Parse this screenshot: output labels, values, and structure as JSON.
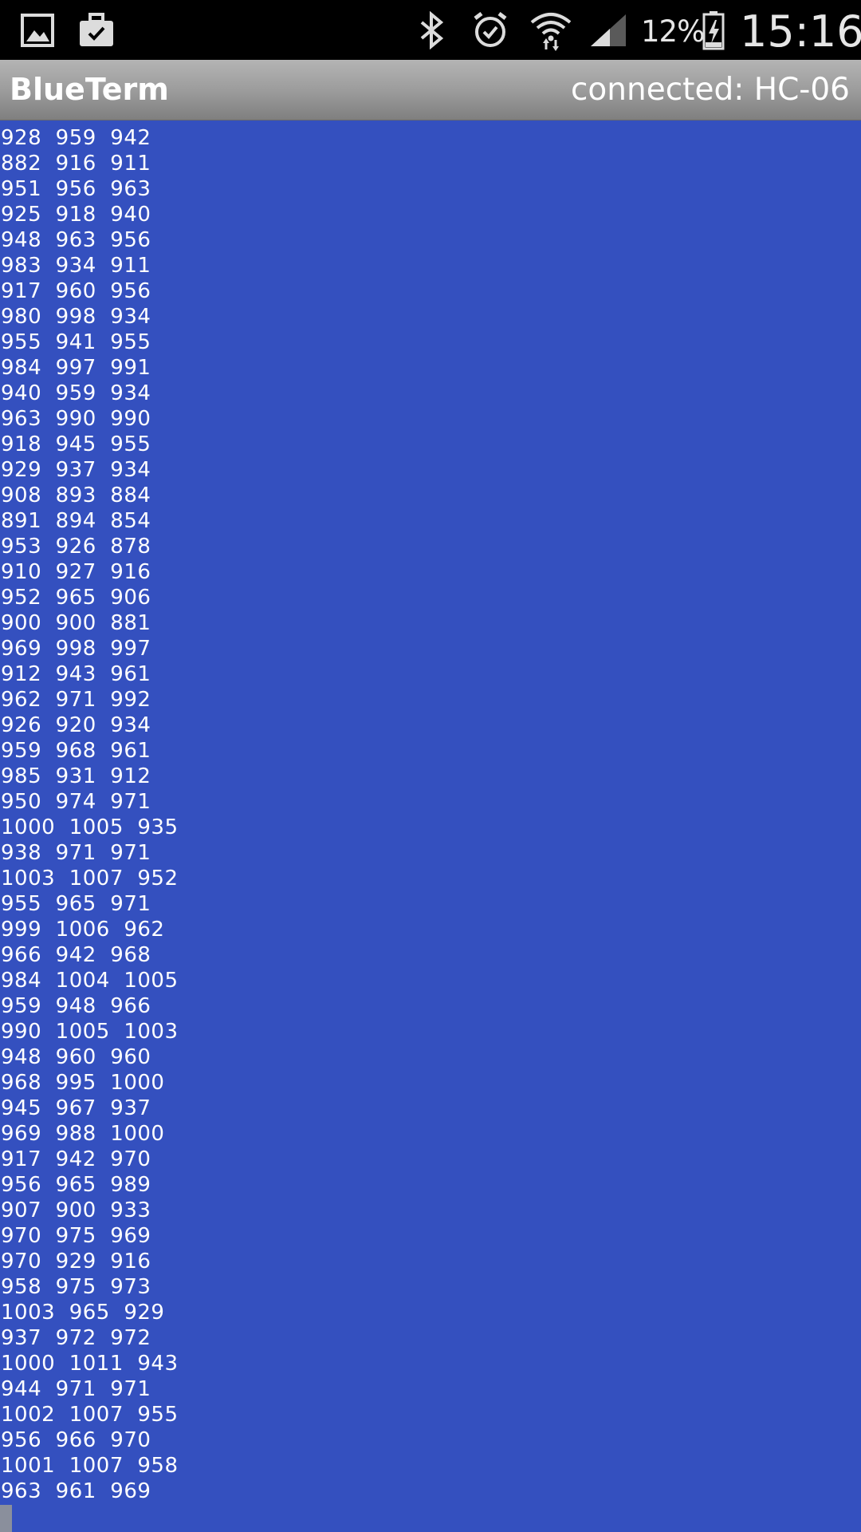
{
  "status_bar": {
    "icons": [
      "gallery-icon",
      "briefcase-icon",
      "bluetooth-icon",
      "alarm-icon",
      "wifi-icon",
      "signal-icon",
      "battery-icon"
    ],
    "battery_percent": "12%",
    "time": "15:16"
  },
  "action_bar": {
    "title": "BlueTerm",
    "connection_status": "connected: HC-06"
  },
  "terminal": {
    "background_color": "#3450bf",
    "text_color": "#ffffff",
    "lines": [
      "928  959  942",
      "882  916  911",
      "951  956  963",
      "925  918  940",
      "948  963  956",
      "983  934  911",
      "917  960  956",
      "980  998  934",
      "955  941  955",
      "984  997  991",
      "940  959  934",
      "963  990  990",
      "918  945  955",
      "929  937  934",
      "908  893  884",
      "891  894  854",
      "953  926  878",
      "910  927  916",
      "952  965  906",
      "900  900  881",
      "969  998  997",
      "912  943  961",
      "962  971  992",
      "926  920  934",
      "959  968  961",
      "985  931  912",
      "950  974  971",
      "1000  1005  935",
      "938  971  971",
      "1003  1007  952",
      "955  965  971",
      "999  1006  962",
      "966  942  968",
      "984  1004  1005",
      "959  948  966",
      "990  1005  1003",
      "948  960  960",
      "968  995  1000",
      "945  967  937",
      "969  988  1000",
      "917  942  970",
      "956  965  989",
      "907  900  933",
      "970  975  969",
      "970  929  916",
      "958  975  973",
      "1003  965  929",
      "937  972  972",
      "1000  1011  943",
      "944  971  971",
      "1002  1007  955",
      "956  966  970",
      "1001  1007  958",
      "963  961  969"
    ]
  }
}
